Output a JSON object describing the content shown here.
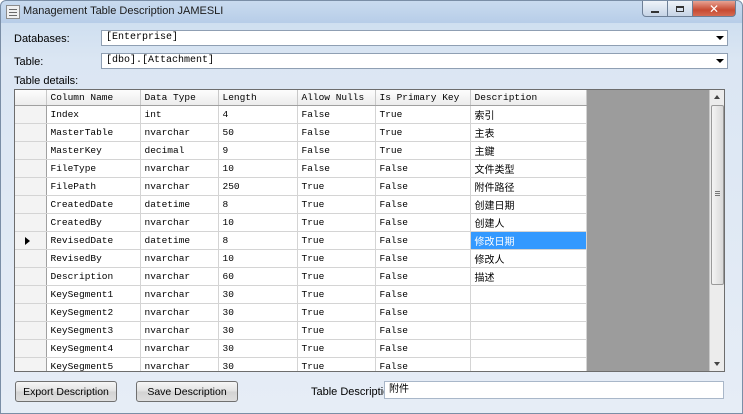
{
  "window": {
    "title": "Management Table Description JAMESLI"
  },
  "databases": {
    "label": "Databases:",
    "value": "[Enterprise]"
  },
  "table": {
    "label": "Table:",
    "value": "[dbo].[Attachment]"
  },
  "table_details": {
    "label": "Table details:",
    "columns": [
      "Column Name",
      "Data Type",
      "Length",
      "Allow Nulls",
      "Is Primary Key",
      "Description"
    ],
    "selected_row_index": 7,
    "rows": [
      [
        "Index",
        "int",
        "4",
        "False",
        "True",
        "索引"
      ],
      [
        "MasterTable",
        "nvarchar",
        "50",
        "False",
        "True",
        "主表"
      ],
      [
        "MasterKey",
        "decimal",
        "9",
        "False",
        "True",
        "主鍵"
      ],
      [
        "FileType",
        "nvarchar",
        "10",
        "False",
        "False",
        "文件类型"
      ],
      [
        "FilePath",
        "nvarchar",
        "250",
        "True",
        "False",
        "附件路径"
      ],
      [
        "CreatedDate",
        "datetime",
        "8",
        "True",
        "False",
        "创建日期"
      ],
      [
        "CreatedBy",
        "nvarchar",
        "10",
        "True",
        "False",
        "创建人"
      ],
      [
        "RevisedDate",
        "datetime",
        "8",
        "True",
        "False",
        "修改日期"
      ],
      [
        "RevisedBy",
        "nvarchar",
        "10",
        "True",
        "False",
        "修改人"
      ],
      [
        "Description",
        "nvarchar",
        "60",
        "True",
        "False",
        "描述"
      ],
      [
        "KeySegment1",
        "nvarchar",
        "30",
        "True",
        "False",
        ""
      ],
      [
        "KeySegment2",
        "nvarchar",
        "30",
        "True",
        "False",
        ""
      ],
      [
        "KeySegment3",
        "nvarchar",
        "30",
        "True",
        "False",
        ""
      ],
      [
        "KeySegment4",
        "nvarchar",
        "30",
        "True",
        "False",
        ""
      ],
      [
        "KeySegment5",
        "nvarchar",
        "30",
        "True",
        "False",
        ""
      ]
    ]
  },
  "buttons": {
    "export": "Export Description",
    "save": "Save Description"
  },
  "table_description": {
    "label": "Table Description:",
    "value": "附件"
  }
}
